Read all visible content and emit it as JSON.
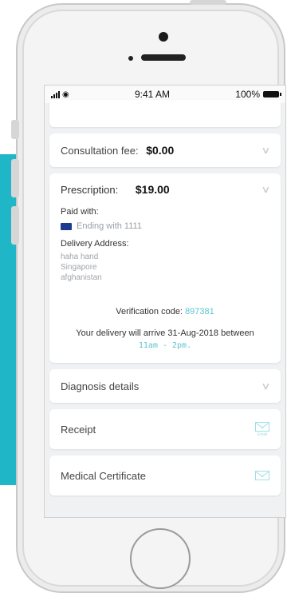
{
  "status_bar": {
    "time": "9:41 AM",
    "battery_pct": "100%"
  },
  "cards": {
    "consultation": {
      "label": "Consultation fee:",
      "amount": "$0.00"
    },
    "prescription": {
      "label": "Prescription:",
      "amount": "$19.00",
      "paid_with_label": "Paid with:",
      "card_text": "Ending with 1111",
      "delivery_address_label": "Delivery Address:",
      "address_lines": [
        "haha hand",
        "Singapore",
        "afghanistan"
      ],
      "verification_label": "Verification code:",
      "verification_code": "897381",
      "delivery_text": "Your delivery will arrive 31-Aug-2018 between",
      "delivery_time": "11am - 2pm."
    },
    "diagnosis": {
      "label": "Diagnosis details"
    },
    "receipt": {
      "label": "Receipt",
      "icon_caption": "Email"
    },
    "medical_certificate": {
      "label": "Medical Certificate"
    }
  },
  "colors": {
    "accent": "#5cc4d0",
    "panel": "#1fb7c7",
    "visa": "#1a3a8f"
  },
  "icons": [
    "chevron-down-icon",
    "visa-card-icon",
    "email-icon",
    "signal-icon",
    "wifi-icon",
    "battery-icon"
  ]
}
